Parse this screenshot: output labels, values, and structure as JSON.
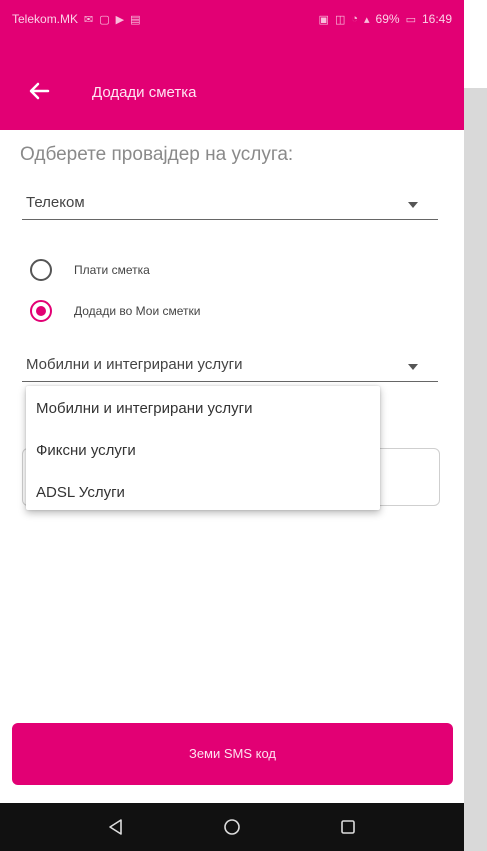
{
  "colors": {
    "accent": "#e20074",
    "app_bar": "#e20074",
    "nav_bar": "#111111"
  },
  "status_bar": {
    "carrier": "Telekom.MK",
    "battery": "69%",
    "time": "16:49"
  },
  "app_bar": {
    "title": "Додади сметка",
    "back_icon": "back-arrow-icon"
  },
  "form": {
    "provider_label": "Одберете провајдер на услуга:",
    "provider_value": "Телеком",
    "radio_options": [
      {
        "label": "Плати сметка",
        "checked": false
      },
      {
        "label": "Додади во Мои сметки",
        "checked": true
      }
    ],
    "service_value": "Мобилни и интегрирани услуги"
  },
  "dropdown_menu": {
    "options": [
      "Мобилни и интегрирани услуги",
      "Фиксни услуги",
      "ADSL Услуги"
    ]
  },
  "cta": {
    "label": "Земи SMS код"
  },
  "nav": {
    "icons": [
      "nav-back-icon",
      "nav-home-icon",
      "nav-recents-icon"
    ]
  }
}
